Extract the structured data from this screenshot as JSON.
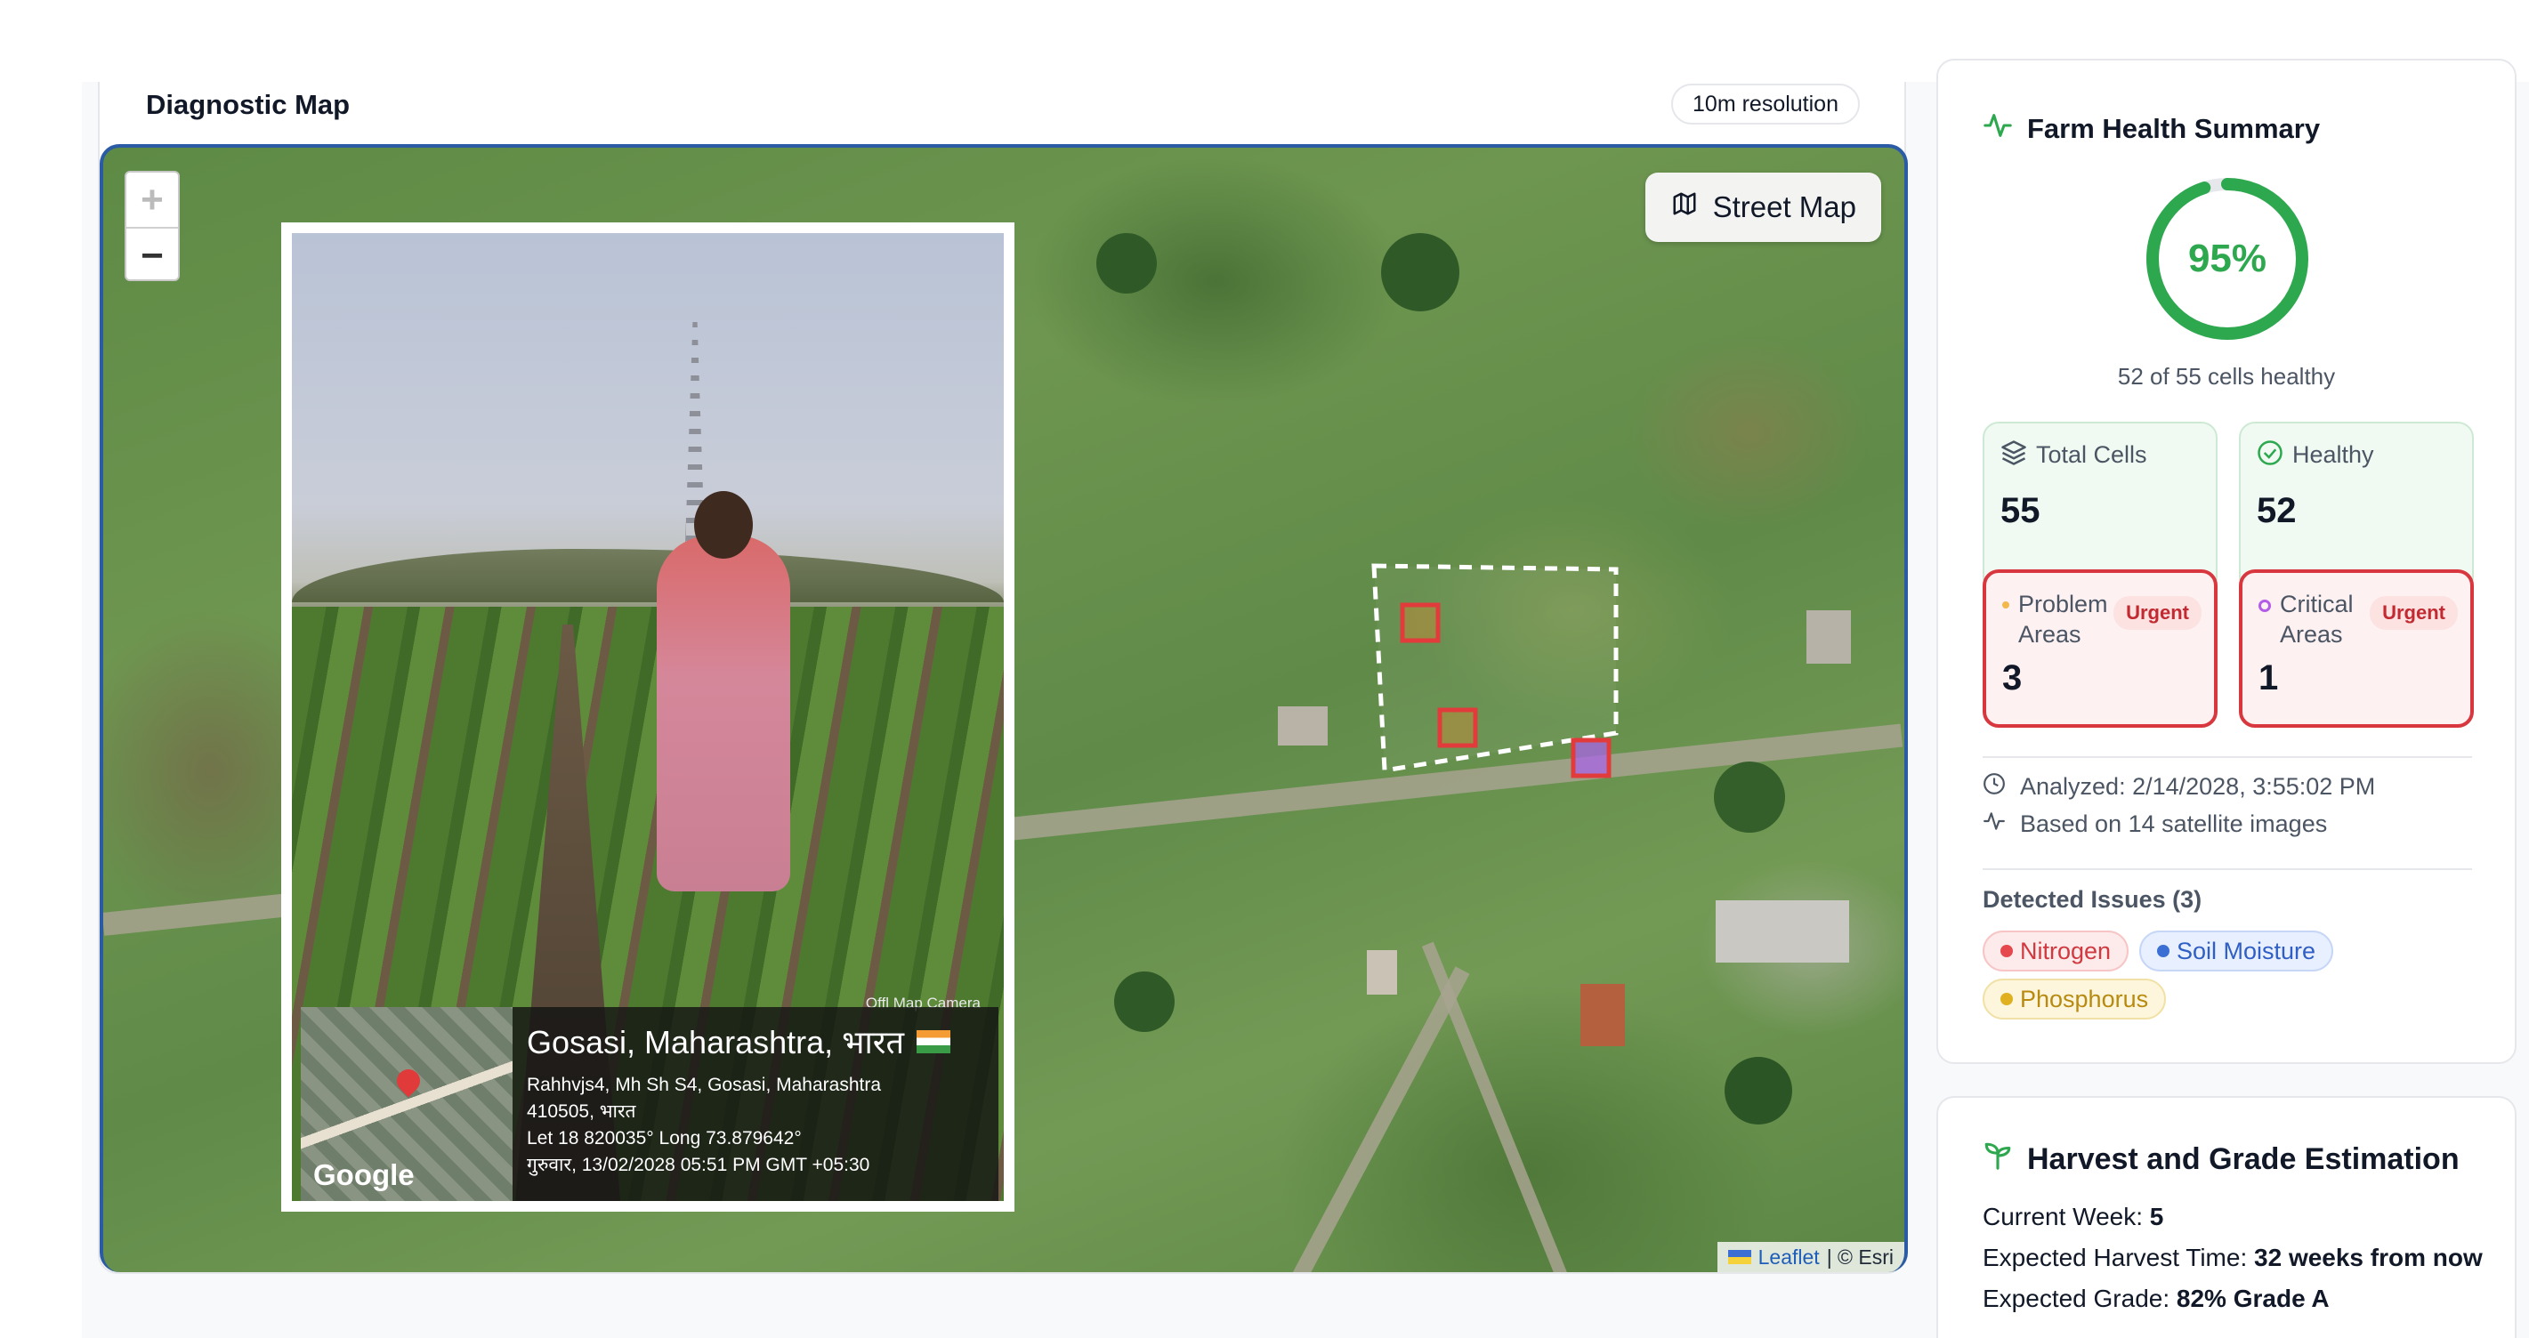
{
  "map": {
    "title": "Diagnostic Map",
    "resolution_badge": "10m resolution",
    "zoom_in": "+",
    "zoom_out": "−",
    "layer_toggle": "Street Map",
    "attribution_leaflet": "Leaflet",
    "attribution_separator": "| © Esri",
    "photo": {
      "watermark": "Offl Map Camera",
      "google_label": "Google",
      "place": "Gosasi, Maharashtra, भारत",
      "address_line_1": "Rahhvjs4, Mh Sh S4, Gosasi, Maharashtra",
      "address_line_2": "410505, भारत",
      "coords": "Let 18 820035° Long 73.879642°",
      "timestamp": "गुरुवार, 13/02/2028 05:51 PM GMT +05:30"
    },
    "cell_status_colors": {
      "problem": "#e23b3b",
      "critical": "#b45ce8",
      "boundary": "#ffffff"
    }
  },
  "summary": {
    "title": "Farm Health Summary",
    "health_percent": 95,
    "health_label": "95%",
    "healthy_caption": "52 of 55 cells healthy",
    "total_cells_label": "Total Cells",
    "total_cells": "55",
    "healthy_label": "Healthy",
    "healthy": "52",
    "problem_label_1": "Problem",
    "problem_label_2": "Areas",
    "problem": "3",
    "critical_label_1": "Critical",
    "critical_label_2": "Areas",
    "critical": "1",
    "urgent_badge": "Urgent",
    "analyzed": "Analyzed: 2/14/2028, 3:55:02 PM",
    "based_on": "Based on 14 satellite images",
    "issues_title": "Detected Issues (3)",
    "issues": [
      {
        "label": "Nitrogen",
        "color": "#e5484d",
        "bg": "#fdeaea",
        "border": "#f7c5c5",
        "text": "#d0393f"
      },
      {
        "label": "Soil Moisture",
        "color": "#3b6fd4",
        "bg": "#e8efff",
        "border": "#c6d6f7",
        "text": "#2f5fc4"
      },
      {
        "label": "Phosphorus",
        "color": "#e0b020",
        "bg": "#fdf6dd",
        "border": "#f1e1a6",
        "text": "#b88a10"
      }
    ],
    "accent_color": "#2ea84f"
  },
  "harvest": {
    "title": "Harvest and Grade Estimation",
    "week_label": "Current Week: ",
    "week_value": "5",
    "time_label": "Expected Harvest Time: ",
    "time_value": "32 weeks from now",
    "grade_label": "Expected Grade: ",
    "grade_value": "82% Grade A"
  }
}
